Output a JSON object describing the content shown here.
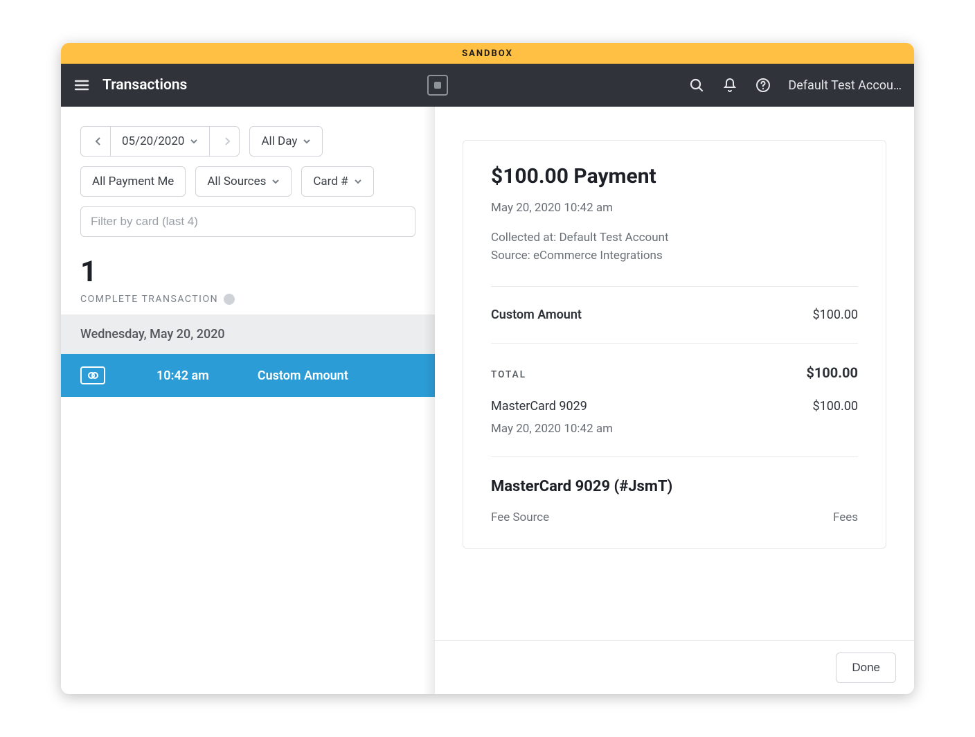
{
  "sandbox_label": "SANDBOX",
  "header": {
    "title": "Transactions",
    "account_label": "Default Test Accou…"
  },
  "filters": {
    "date": "05/20/2020",
    "time": "All Day",
    "payment_methods": "All Payment Me",
    "sources": "All Sources",
    "card_filter_label": "Card #",
    "card_input_placeholder": "Filter by card (last 4)"
  },
  "summary": {
    "count": "1",
    "count_label": "COMPLETE TRANSACTION"
  },
  "list": {
    "date_header": "Wednesday, May 20, 2020",
    "items": [
      {
        "time": "10:42 am",
        "desc": "Custom Amount"
      }
    ]
  },
  "detail": {
    "title": "$100.00 Payment",
    "timestamp": "May 20, 2020 10:42 am",
    "collected_at": "Collected at: Default Test Account",
    "source": "Source: eCommerce Integrations",
    "item_label": "Custom Amount",
    "item_amount": "$100.00",
    "total_label": "TOTAL",
    "total_amount": "$100.00",
    "pay_method": "MasterCard 9029",
    "pay_amount": "$100.00",
    "pay_timestamp": "May 20, 2020 10:42 am",
    "section_title": "MasterCard 9029 (#JsmT)",
    "fee_label": "Fee Source",
    "fee_amount": "Fees",
    "done_label": "Done"
  }
}
